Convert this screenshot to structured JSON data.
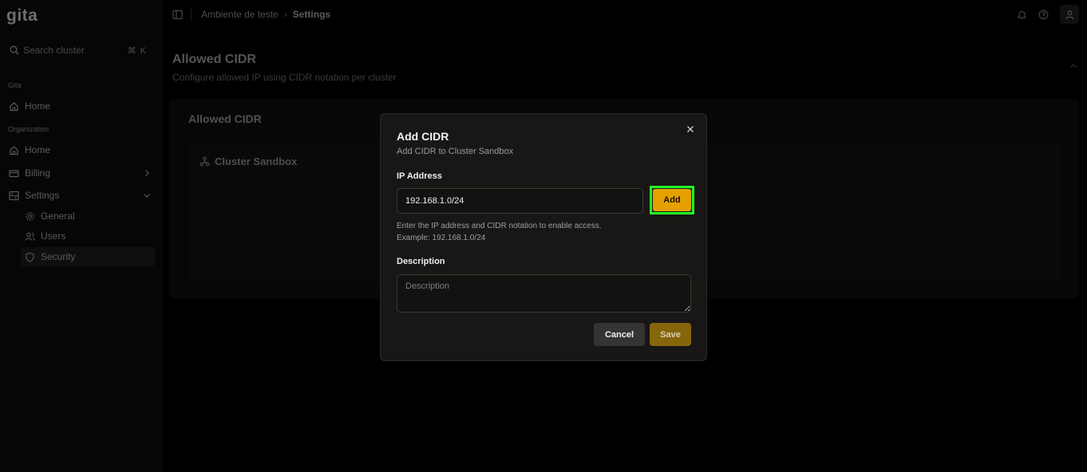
{
  "app": {
    "logo": "gita"
  },
  "sidebar": {
    "search_placeholder": "Search cluster",
    "search_shortcut": "⌘ K",
    "section_gita": "Gita",
    "home_label": "Home",
    "section_org": "Organization",
    "org_home_label": "Home",
    "billing_label": "Billing",
    "settings_label": "Settings",
    "general_label": "General",
    "users_label": "Users",
    "security_label": "Security"
  },
  "topbar": {
    "breadcrumb_parent": "Ambiente de teste",
    "breadcrumb_separator": "›",
    "breadcrumb_current": "Settings"
  },
  "main": {
    "title": "Allowed CIDR",
    "subtitle": "Configure allowed IP using CIDR notation per cluster",
    "card_title": "Allowed CIDR",
    "cluster_name": "Cluster Sandbox"
  },
  "modal": {
    "title": "Add CIDR",
    "subtitle": "Add CIDR to Cluster Sandbox",
    "ip_label": "IP Address",
    "ip_value": "192.168.1.0/24",
    "add_label": "Add",
    "help_line1": "Enter the IP address and CIDR notation to enable access.",
    "help_line2": "Example: 192.168.1.0/24",
    "description_label": "Description",
    "description_placeholder": "Description",
    "cancel_label": "Cancel",
    "save_label": "Save"
  },
  "colors": {
    "accent": "#e6a100",
    "highlight": "#22ff22",
    "save_disabled": "#86650c"
  }
}
